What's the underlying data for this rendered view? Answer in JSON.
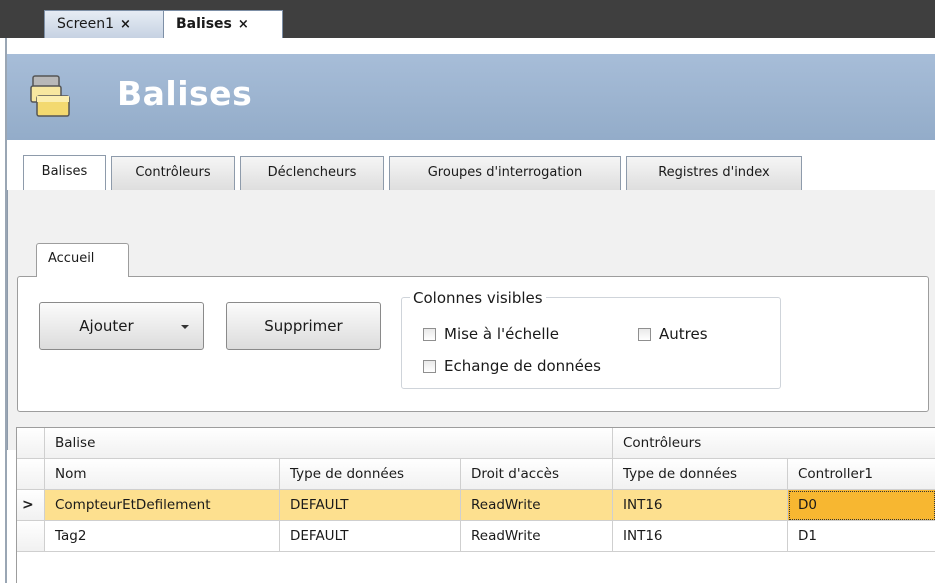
{
  "doc_tabs": [
    {
      "label": "Screen1",
      "close": "×"
    },
    {
      "label": "Balises",
      "close": "×"
    }
  ],
  "header": {
    "title": "Balises",
    "icon": "tags-folder-icon"
  },
  "main_tabs": [
    "Balises",
    "Contrôleurs",
    "Déclencheurs",
    "Groupes d'interrogation",
    "Registres d'index"
  ],
  "ribbon": {
    "tab": "Accueil",
    "add_label": "Ajouter",
    "delete_label": "Supprimer",
    "group_title": "Colonnes visibles",
    "checkboxes": [
      "Mise à l'échelle",
      "Autres",
      "Echange de données"
    ]
  },
  "grid": {
    "group_headers": {
      "balise": "Balise",
      "controleurs": "Contrôleurs"
    },
    "columns": [
      "Nom",
      "Type de données",
      "Droit d'accès",
      "Type de données",
      "Controller1"
    ],
    "rows": [
      {
        "indicator": ">",
        "cells": [
          "CompteurEtDefilement",
          "DEFAULT",
          "ReadWrite",
          "INT16",
          "D0"
        ]
      },
      {
        "indicator": "",
        "cells": [
          "Tag2",
          "DEFAULT",
          "ReadWrite",
          "INT16",
          "D1"
        ]
      }
    ]
  },
  "colors": {
    "header_bg": "#9cb3d0",
    "selected_row": "#fde08f",
    "focused_cell": "#f7b731"
  }
}
